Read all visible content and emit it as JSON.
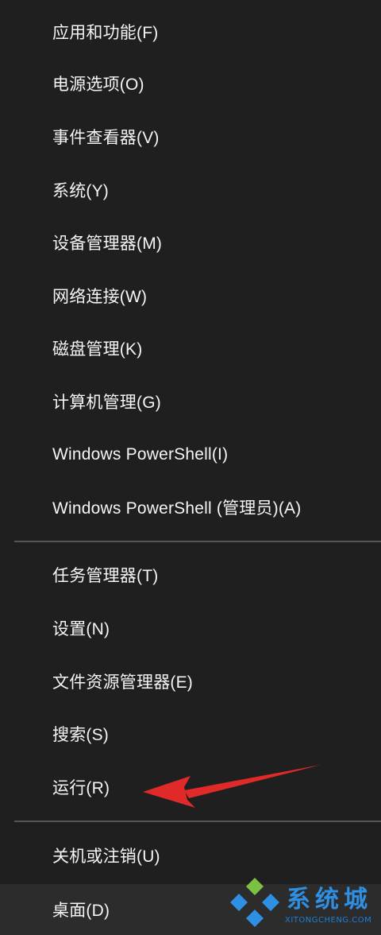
{
  "menu": {
    "items": [
      {
        "label": "应用和功能(F)"
      },
      {
        "label": "电源选项(O)"
      },
      {
        "label": "事件查看器(V)"
      },
      {
        "label": "系统(Y)"
      },
      {
        "label": "设备管理器(M)"
      },
      {
        "label": "网络连接(W)"
      },
      {
        "label": "磁盘管理(K)"
      },
      {
        "label": "计算机管理(G)"
      },
      {
        "label": "Windows PowerShell(I)"
      },
      {
        "label": "Windows PowerShell (管理员)(A)"
      },
      {
        "label": "任务管理器(T)"
      },
      {
        "label": "设置(N)"
      },
      {
        "label": "文件资源管理器(E)"
      },
      {
        "label": "搜索(S)"
      },
      {
        "label": "运行(R)"
      },
      {
        "label": "关机或注销(U)"
      },
      {
        "label": "桌面(D)"
      }
    ]
  },
  "watermark": {
    "text": "系统城",
    "subtext": "XITONGCHENG.COM"
  },
  "colors": {
    "background": "#1f1f1f",
    "text": "#f5f5f5",
    "separator": "#555555",
    "arrow": "#e02a2a",
    "watermark": "#2e8fe3"
  }
}
